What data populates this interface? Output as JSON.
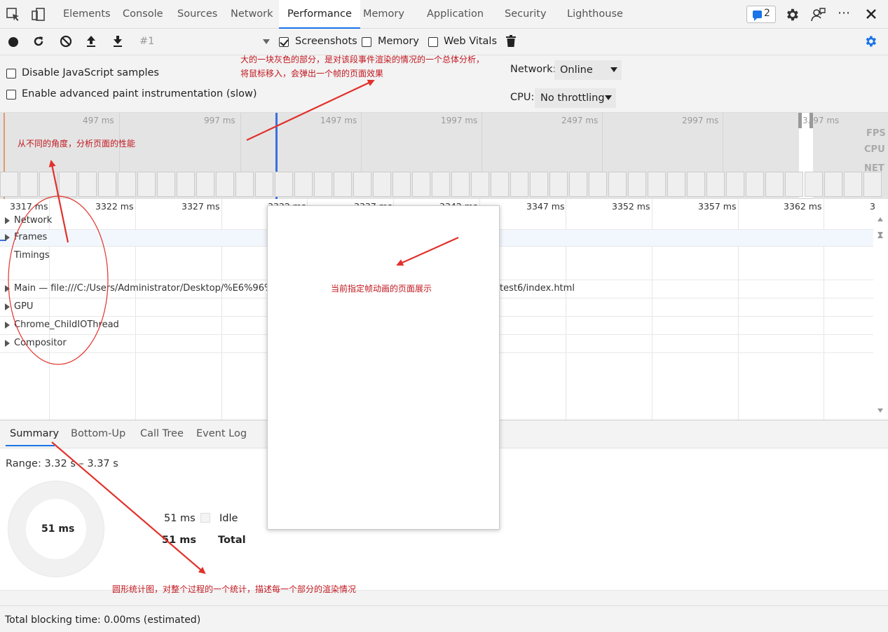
{
  "tabs": {
    "items": [
      "Elements",
      "Console",
      "Sources",
      "Network",
      "Performance",
      "Memory",
      "Application",
      "Security",
      "Lighthouse"
    ],
    "active": "Performance",
    "issues_count": "2"
  },
  "toolbar": {
    "profile_select": "#1",
    "screenshots_label": "Screenshots",
    "memory_label": "Memory",
    "web_vitals_label": "Web Vitals",
    "screenshots_checked": true,
    "memory_checked": false,
    "web_vitals_checked": false
  },
  "settings": {
    "disable_js_samples": "Disable JavaScript samples",
    "enable_paint": "Enable advanced paint instrumentation (slow)",
    "network_label": "Network:",
    "network_value": "Online",
    "cpu_label": "CPU:",
    "cpu_value": "No throttling"
  },
  "overview": {
    "ticks": [
      "497 ms",
      "997 ms",
      "1497 ms",
      "1997 ms",
      "2497 ms",
      "2997 ms",
      "3..97 ms"
    ],
    "fps_label": "FPS",
    "cpu_label": "CPU",
    "net_label": "NET"
  },
  "timeline": {
    "ticks": [
      "3317 ms",
      "3322 ms",
      "3327 ms",
      "3332 ms",
      "3337 ms",
      "3342 ms",
      "3347 ms",
      "3352 ms",
      "3357 ms",
      "3362 ms",
      "3"
    ],
    "tracks": {
      "network": "Network",
      "frames": "Frames",
      "timings": "Timings",
      "main": "Main — file:///C:/Users/Administrator/Desktop/%E6%96%B0",
      "main_tail": "test6/index.html",
      "gpu": "GPU",
      "child_io": "Chrome_ChildIOThread",
      "compositor": "Compositor"
    }
  },
  "bottom": {
    "tabs": [
      "Summary",
      "Bottom-Up",
      "Call Tree",
      "Event Log"
    ],
    "active": "Summary",
    "range": "Range: 3.32 s – 3.37 s",
    "donut_center": "51 ms",
    "idle_value": "51 ms",
    "idle_label": "Idle",
    "total_value": "51 ms",
    "total_label": "Total"
  },
  "status": {
    "text": "Total blocking time: 0.00ms (estimated)"
  },
  "annotations": {
    "gray_area_1": "大的一块灰色的部分，是对该段事件渲染的情况的一个总体分析，",
    "gray_area_2": "将鼠标移入，会弹出一个帧的页面效果",
    "angles": "从不同的角度，分析页面的性能",
    "frame_preview": "当前指定帧动画的页面展示",
    "pie_chart": "圆形统计图，对整个过程的一个统计，描述每一个部分的渲染情况"
  },
  "colors": {
    "accent_blue": "#1a73e8",
    "annotation_red": "#e2312b"
  }
}
